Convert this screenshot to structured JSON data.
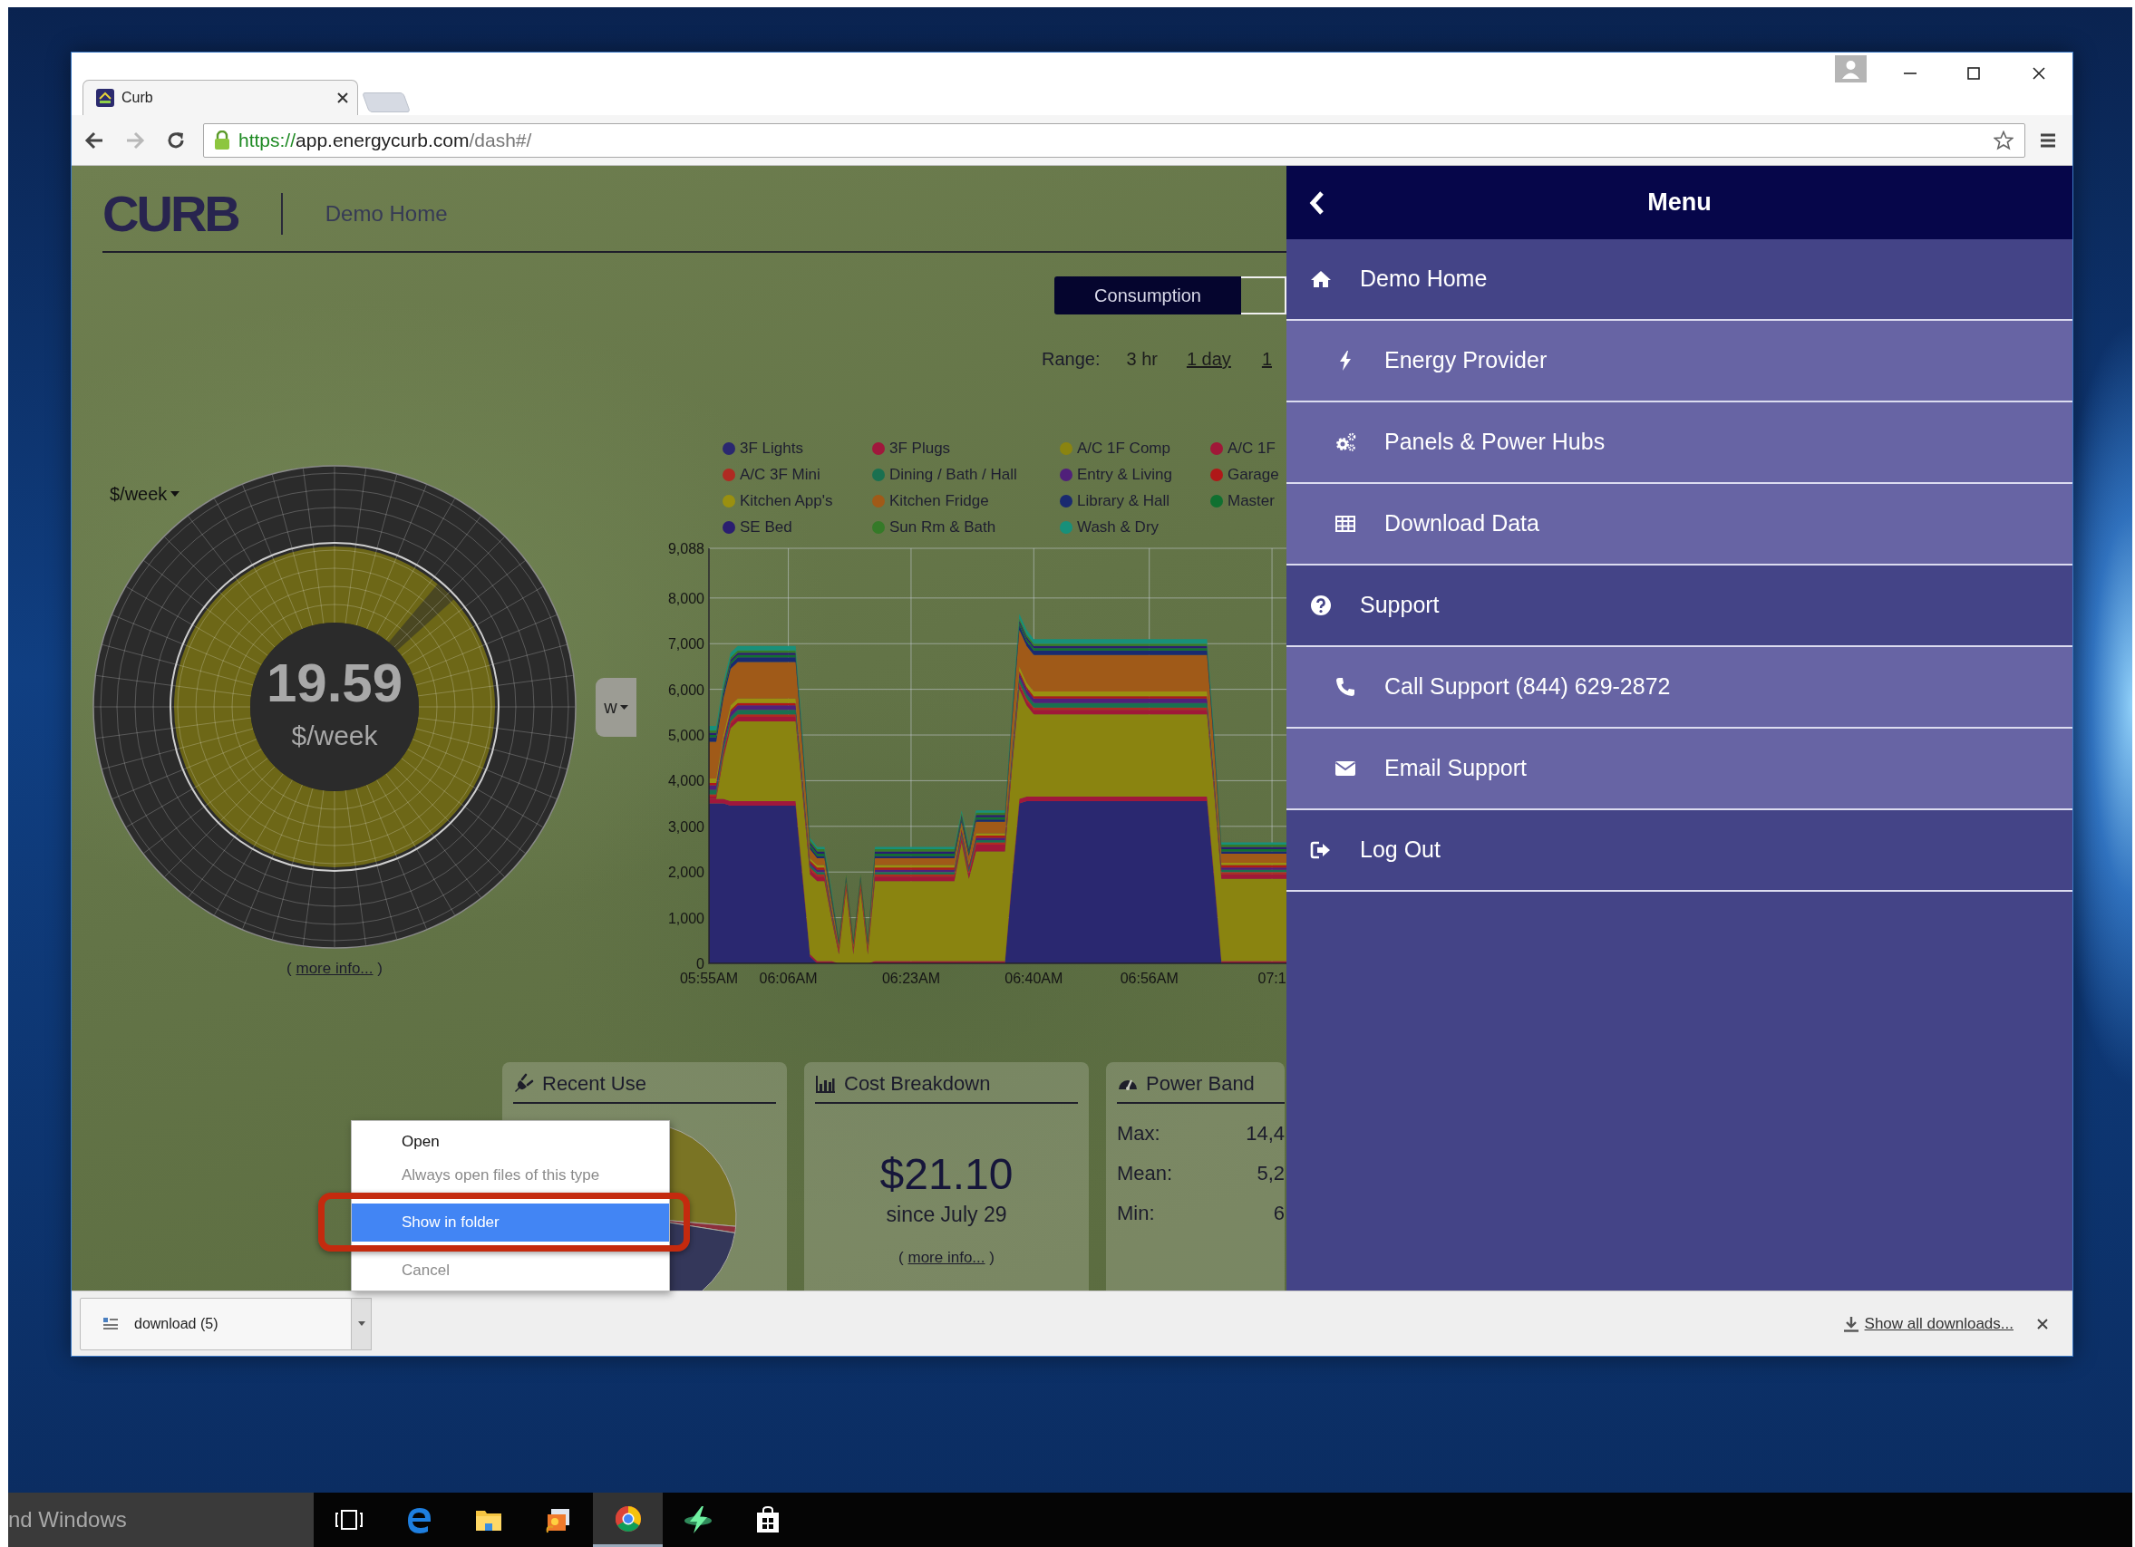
{
  "browser": {
    "tab": {
      "title": "Curb",
      "selected": true
    },
    "url": {
      "scheme": "https://",
      "host": "app.energycurb.com",
      "path": "/dash#/"
    }
  },
  "dashboard": {
    "logo": "CURB",
    "location": "Demo Home",
    "view_toggle": [
      {
        "label": "Consumption",
        "selected": true
      }
    ],
    "range": {
      "label": "Range:",
      "options": [
        {
          "label": "3 hr",
          "selected": true
        },
        {
          "label": "1 day",
          "selected": false
        },
        {
          "label": "1",
          "selected": false
        }
      ]
    },
    "gauge": {
      "unit_menu": "$/week",
      "value": "19.59",
      "unit": "$/week",
      "period_button": "w",
      "more_info": {
        "before": "(",
        "link": "more info...",
        "after": ")"
      }
    },
    "chart": {
      "chart_data": {
        "type": "area",
        "stacked": true,
        "categories": [
          "05:55AM",
          null,
          null,
          null,
          null,
          null,
          null,
          null,
          null,
          null,
          null,
          "06:06AM",
          null,
          null,
          null,
          null,
          null,
          null,
          null,
          null,
          null,
          null,
          null,
          null,
          null,
          null,
          null,
          null,
          "06:23AM",
          null,
          null,
          null,
          null,
          null,
          null,
          null,
          null,
          null,
          null,
          null,
          null,
          null,
          null,
          null,
          null,
          "06:40AM",
          null,
          null,
          null,
          null,
          null,
          null,
          null,
          null,
          null,
          null,
          null,
          null,
          null,
          null,
          null,
          "06:56AM",
          null,
          null,
          null,
          null,
          null,
          null,
          null,
          null,
          null,
          null,
          null,
          null,
          null,
          null,
          null,
          null,
          "07:1",
          null,
          null
        ],
        "series": [
          {
            "name": "3F Lights",
            "color": "#2a2870",
            "values": [
              3500,
              3500,
              3500,
              3450,
              3450,
              3450,
              3450,
              3450,
              3450,
              3450,
              3450,
              3450,
              3450,
              1800,
              150,
              0,
              0,
              0,
              0,
              0,
              0,
              0,
              0,
              0,
              0,
              0,
              0,
              0,
              0,
              0,
              0,
              0,
              0,
              0,
              0,
              0,
              0,
              0,
              0,
              0,
              0,
              0,
              1800,
              3500,
              3550,
              3550,
              3550,
              3550,
              3550,
              3550,
              3550,
              3550,
              3550,
              3550,
              3550,
              3550,
              3550,
              3550,
              3550,
              3550,
              3550,
              3550,
              3550,
              3550,
              3550,
              3550,
              3550,
              3550,
              3550,
              3550,
              1800,
              0,
              0,
              0,
              0,
              0,
              0,
              0,
              0,
              0,
              0
            ]
          },
          {
            "name": "3F Plugs",
            "color": "#a0183c",
            "values": [
              100,
              100,
              100,
              100,
              100,
              100,
              100,
              100,
              100,
              100,
              100,
              100,
              100,
              100,
              50,
              50,
              50,
              50,
              0,
              0,
              0,
              0,
              0,
              50,
              50,
              50,
              50,
              50,
              50,
              50,
              50,
              50,
              50,
              50,
              50,
              50,
              50,
              50,
              50,
              50,
              50,
              50,
              100,
              100,
              100,
              100,
              100,
              100,
              100,
              100,
              100,
              100,
              100,
              100,
              100,
              100,
              100,
              100,
              100,
              100,
              100,
              100,
              100,
              100,
              100,
              100,
              100,
              100,
              100,
              100,
              100,
              50,
              50,
              50,
              50,
              50,
              50,
              50,
              50,
              50,
              50
            ]
          },
          {
            "name": "A/C 1F Comp",
            "color": "#8a8410",
            "values": [
              0,
              0,
              900,
              1600,
              1750,
              1750,
              1750,
              1750,
              1750,
              1750,
              1750,
              1750,
              1750,
              1750,
              1750,
              1750,
              1750,
              900,
              200,
              1600,
              200,
              1600,
              200,
              1750,
              1750,
              1750,
              1750,
              1750,
              1750,
              1750,
              1750,
              1750,
              1750,
              1750,
              1750,
              2600,
              1800,
              2400,
              2400,
              2400,
              2400,
              2400,
              2400,
              2400,
              2000,
              1800,
              1800,
              1800,
              1800,
              1800,
              1800,
              1800,
              1800,
              1800,
              1800,
              1800,
              1800,
              1800,
              1800,
              1800,
              1800,
              1800,
              1800,
              1800,
              1800,
              1800,
              1800,
              1800,
              1800,
              1800,
              1800,
              1800,
              1800,
              1800,
              1800,
              1800,
              1800,
              1800,
              1800,
              1800,
              1800
            ]
          },
          {
            "name": "A/C 1F",
            "color": "#a01838",
            "values": [
              50,
              50,
              100,
              100,
              100,
              100,
              100,
              100,
              100,
              100,
              100,
              100,
              100,
              100,
              100,
              100,
              100,
              50,
              50,
              50,
              50,
              50,
              50,
              100,
              100,
              100,
              100,
              100,
              100,
              100,
              100,
              100,
              100,
              100,
              100,
              100,
              100,
              150,
              150,
              150,
              150,
              150,
              100,
              100,
              100,
              100,
              100,
              100,
              100,
              100,
              100,
              100,
              100,
              100,
              100,
              100,
              100,
              100,
              100,
              100,
              100,
              100,
              100,
              100,
              100,
              100,
              100,
              100,
              100,
              100,
              100,
              100,
              100,
              100,
              100,
              100,
              100,
              100,
              100,
              100,
              100
            ]
          },
          {
            "name": "A/C 3F Mini",
            "color": "#b02a22",
            "values": [
              50,
              50,
              50,
              50,
              50,
              50,
              50,
              50,
              50,
              50,
              50,
              50,
              50,
              50,
              50,
              50,
              50,
              50,
              50,
              50,
              50,
              50,
              50,
              50,
              50,
              50,
              50,
              50,
              50,
              50,
              50,
              50,
              50,
              50,
              50,
              50,
              50,
              50,
              50,
              50,
              50,
              50,
              50,
              50,
              50,
              50,
              50,
              50,
              50,
              50,
              50,
              50,
              50,
              50,
              50,
              50,
              50,
              50,
              50,
              50,
              50,
              50,
              50,
              50,
              50,
              50,
              50,
              50,
              50,
              50,
              50,
              50,
              50,
              50,
              50,
              50,
              50,
              50,
              50,
              50,
              50
            ]
          },
          {
            "name": "Dining / Bath / Hall",
            "color": "#1a7050",
            "values": [
              100,
              100,
              100,
              100,
              100,
              100,
              100,
              100,
              100,
              100,
              100,
              100,
              100,
              100,
              50,
              50,
              50,
              50,
              0,
              0,
              0,
              0,
              0,
              50,
              50,
              50,
              50,
              50,
              50,
              50,
              50,
              50,
              50,
              50,
              50,
              50,
              50,
              50,
              50,
              50,
              50,
              50,
              100,
              100,
              100,
              100,
              100,
              100,
              100,
              100,
              100,
              100,
              100,
              100,
              100,
              100,
              100,
              100,
              100,
              100,
              100,
              100,
              100,
              100,
              100,
              100,
              100,
              100,
              100,
              100,
              100,
              50,
              50,
              50,
              50,
              50,
              50,
              50,
              50,
              50,
              50
            ]
          },
          {
            "name": "Entry & Living",
            "color": "#50207a",
            "values": [
              100,
              100,
              100,
              100,
              100,
              100,
              100,
              100,
              100,
              100,
              100,
              100,
              100,
              100,
              50,
              50,
              50,
              50,
              0,
              0,
              0,
              0,
              0,
              50,
              50,
              50,
              50,
              50,
              50,
              50,
              50,
              50,
              50,
              50,
              50,
              50,
              50,
              50,
              50,
              50,
              50,
              50,
              100,
              100,
              100,
              100,
              100,
              100,
              100,
              100,
              100,
              100,
              100,
              100,
              100,
              100,
              100,
              100,
              100,
              100,
              100,
              100,
              100,
              100,
              100,
              100,
              100,
              100,
              100,
              100,
              100,
              50,
              50,
              50,
              50,
              50,
              50,
              50,
              50,
              50,
              50
            ]
          },
          {
            "name": "Garage",
            "color": "#b01818",
            "values": [
              50,
              50,
              50,
              50,
              50,
              50,
              50,
              50,
              50,
              50,
              50,
              50,
              50,
              50,
              50,
              50,
              50,
              50,
              50,
              50,
              50,
              50,
              50,
              50,
              50,
              50,
              50,
              50,
              50,
              50,
              50,
              50,
              50,
              50,
              50,
              50,
              50,
              50,
              50,
              50,
              50,
              50,
              50,
              50,
              50,
              50,
              50,
              50,
              50,
              50,
              50,
              50,
              50,
              50,
              50,
              50,
              50,
              50,
              50,
              50,
              50,
              50,
              50,
              50,
              50,
              50,
              50,
              50,
              50,
              50,
              50,
              50,
              50,
              50,
              50,
              50,
              50,
              50,
              50,
              50,
              50
            ]
          },
          {
            "name": "Kitchen App's",
            "color": "#9a9010",
            "values": [
              100,
              100,
              100,
              100,
              100,
              100,
              100,
              100,
              100,
              100,
              100,
              100,
              100,
              100,
              50,
              50,
              50,
              50,
              0,
              0,
              0,
              0,
              0,
              50,
              50,
              50,
              50,
              50,
              50,
              50,
              50,
              50,
              50,
              50,
              50,
              50,
              50,
              50,
              50,
              50,
              50,
              50,
              100,
              100,
              100,
              100,
              100,
              100,
              100,
              100,
              100,
              100,
              100,
              100,
              100,
              100,
              100,
              100,
              100,
              100,
              100,
              100,
              100,
              100,
              100,
              100,
              100,
              100,
              100,
              100,
              100,
              50,
              50,
              50,
              50,
              50,
              50,
              50,
              50,
              50,
              50
            ]
          },
          {
            "name": "Kitchen Fridge",
            "color": "#a05a18",
            "values": [
              800,
              800,
              800,
              800,
              800,
              800,
              800,
              800,
              800,
              800,
              800,
              800,
              800,
              500,
              200,
              150,
              150,
              100,
              50,
              50,
              50,
              50,
              50,
              150,
              150,
              150,
              150,
              150,
              150,
              150,
              150,
              150,
              150,
              150,
              150,
              100,
              150,
              250,
              250,
              250,
              250,
              250,
              500,
              800,
              800,
              800,
              800,
              800,
              800,
              800,
              800,
              800,
              800,
              800,
              800,
              800,
              800,
              800,
              800,
              800,
              800,
              800,
              800,
              800,
              800,
              800,
              800,
              800,
              800,
              800,
              500,
              200,
              200,
              200,
              200,
              200,
              200,
              200,
              200,
              200,
              200
            ]
          },
          {
            "name": "Library & Hall",
            "color": "#1a2a70",
            "values": [
              100,
              100,
              100,
              100,
              100,
              100,
              100,
              100,
              100,
              100,
              100,
              100,
              100,
              100,
              50,
              50,
              50,
              50,
              0,
              0,
              0,
              0,
              0,
              50,
              50,
              50,
              50,
              50,
              50,
              50,
              50,
              50,
              50,
              50,
              50,
              50,
              50,
              50,
              50,
              50,
              50,
              50,
              100,
              100,
              100,
              100,
              100,
              100,
              100,
              100,
              100,
              100,
              100,
              100,
              100,
              100,
              100,
              100,
              100,
              100,
              100,
              100,
              100,
              100,
              100,
              100,
              100,
              100,
              100,
              100,
              100,
              50,
              50,
              50,
              50,
              50,
              50,
              50,
              50,
              50,
              50
            ]
          },
          {
            "name": "Master",
            "color": "#107030",
            "values": [
              50,
              50,
              50,
              50,
              50,
              50,
              50,
              50,
              50,
              50,
              50,
              50,
              50,
              50,
              50,
              50,
              50,
              50,
              50,
              50,
              50,
              50,
              50,
              50,
              50,
              50,
              50,
              50,
              50,
              50,
              50,
              50,
              50,
              50,
              50,
              50,
              50,
              50,
              50,
              50,
              50,
              50,
              50,
              50,
              50,
              50,
              50,
              50,
              50,
              50,
              50,
              50,
              50,
              50,
              50,
              50,
              50,
              50,
              50,
              50,
              50,
              50,
              50,
              50,
              50,
              50,
              50,
              50,
              50,
              50,
              50,
              50,
              50,
              50,
              50,
              50,
              50,
              50,
              50,
              50,
              50
            ]
          },
          {
            "name": "SE Bed",
            "color": "#2a1e70",
            "values": [
              50,
              50,
              50,
              50,
              50,
              50,
              50,
              50,
              50,
              50,
              50,
              50,
              50,
              50,
              50,
              50,
              50,
              50,
              50,
              50,
              50,
              50,
              50,
              50,
              50,
              50,
              50,
              50,
              50,
              50,
              50,
              50,
              50,
              50,
              50,
              50,
              50,
              50,
              50,
              50,
              50,
              50,
              50,
              50,
              50,
              50,
              50,
              50,
              50,
              50,
              50,
              50,
              50,
              50,
              50,
              50,
              50,
              50,
              50,
              50,
              50,
              50,
              50,
              50,
              50,
              50,
              50,
              50,
              50,
              50,
              50,
              50,
              50,
              50,
              50,
              50,
              50,
              50,
              50,
              50,
              50
            ]
          },
          {
            "name": "Sun Rm & Bath",
            "color": "#357a28",
            "values": [
              50,
              50,
              50,
              50,
              50,
              50,
              50,
              50,
              50,
              50,
              50,
              50,
              50,
              50,
              50,
              50,
              50,
              50,
              50,
              50,
              50,
              50,
              50,
              50,
              50,
              50,
              50,
              50,
              50,
              50,
              50,
              50,
              50,
              50,
              50,
              50,
              50,
              50,
              50,
              50,
              50,
              50,
              50,
              50,
              50,
              50,
              50,
              50,
              50,
              50,
              50,
              50,
              50,
              50,
              50,
              50,
              50,
              50,
              50,
              50,
              50,
              50,
              50,
              50,
              50,
              50,
              50,
              50,
              50,
              50,
              50,
              50,
              50,
              50,
              50,
              50,
              50,
              50,
              50,
              50,
              50
            ]
          },
          {
            "name": "Wash & Dry",
            "color": "#18907a",
            "values": [
              100,
              100,
              100,
              100,
              100,
              100,
              100,
              100,
              100,
              100,
              100,
              100,
              100,
              100,
              50,
              50,
              50,
              50,
              0,
              0,
              0,
              0,
              0,
              50,
              50,
              50,
              50,
              50,
              50,
              50,
              50,
              50,
              50,
              50,
              50,
              50,
              50,
              50,
              50,
              50,
              50,
              50,
              100,
              100,
              100,
              100,
              100,
              100,
              100,
              100,
              100,
              100,
              100,
              100,
              100,
              100,
              100,
              100,
              100,
              100,
              100,
              100,
              100,
              100,
              100,
              100,
              100,
              100,
              100,
              100,
              100,
              50,
              50,
              50,
              50,
              50,
              50,
              50,
              50,
              50,
              50
            ]
          }
        ],
        "ylim": [
          0,
          9088
        ],
        "grid": true,
        "legend": "top",
        "yticks": [
          0,
          {
            "value": 1000,
            "label": "1,000"
          },
          {
            "value": 2000,
            "label": "2,000"
          },
          {
            "value": 3000,
            "label": "3,000"
          },
          {
            "value": 4000,
            "label": "4,000"
          },
          {
            "value": 5000,
            "label": "5,000"
          },
          {
            "value": 6000,
            "label": "6,000"
          },
          {
            "value": 7000,
            "label": "7,000"
          },
          {
            "value": 8000,
            "label": "8,000"
          },
          {
            "value": 9088,
            "label": "9,088"
          }
        ]
      }
    },
    "cards": [
      {
        "kind": "recent_use",
        "title": "Recent Use"
      },
      {
        "kind": "cost",
        "title": "Cost Breakdown",
        "amount": "$21.10",
        "since": "since July 29",
        "more_info": {
          "before": "(",
          "link": "more info...",
          "after": ")"
        }
      },
      {
        "kind": "power_band",
        "title": "Power Band",
        "stats": [
          {
            "label": "Max:",
            "value": "14,4"
          },
          {
            "label": "Mean:",
            "value": "5,2"
          },
          {
            "label": "Min:",
            "value": "6"
          }
        ]
      }
    ]
  },
  "menu": {
    "title": "Menu",
    "items": [
      {
        "kind": "section",
        "label": "Demo Home"
      },
      {
        "kind": "link",
        "label": "Energy Provider"
      },
      {
        "kind": "link",
        "label": "Panels & Power Hubs"
      },
      {
        "kind": "link",
        "label": "Download Data"
      },
      {
        "kind": "section",
        "label": "Support"
      },
      {
        "kind": "link",
        "label": "Call Support (844) 629-2872"
      },
      {
        "kind": "link",
        "label": "Email Support"
      },
      {
        "kind": "section",
        "label": "Log Out"
      }
    ]
  },
  "context_menu": {
    "items": [
      {
        "kind": "item",
        "label": "Open",
        "disabled": false,
        "selected": false,
        "highlighted": false
      },
      {
        "kind": "item",
        "label": "Always open files of this type",
        "disabled": true,
        "selected": false,
        "highlighted": false
      },
      {
        "kind": "separator"
      },
      {
        "kind": "item",
        "label": "Show in folder",
        "disabled": false,
        "selected": true,
        "highlighted": true
      },
      {
        "kind": "separator"
      },
      {
        "kind": "item",
        "label": "Cancel",
        "disabled": true,
        "selected": false,
        "highlighted": false
      }
    ]
  },
  "download_bar": {
    "file": "download (5)",
    "show_all": "Show all downloads..."
  },
  "taskbar": {
    "search": "nd Windows",
    "apps": [
      {
        "selected": false
      },
      {
        "selected": false
      },
      {
        "selected": false
      },
      {
        "selected": false
      },
      {
        "selected": true
      },
      {
        "selected": false
      },
      {
        "selected": false
      }
    ]
  }
}
